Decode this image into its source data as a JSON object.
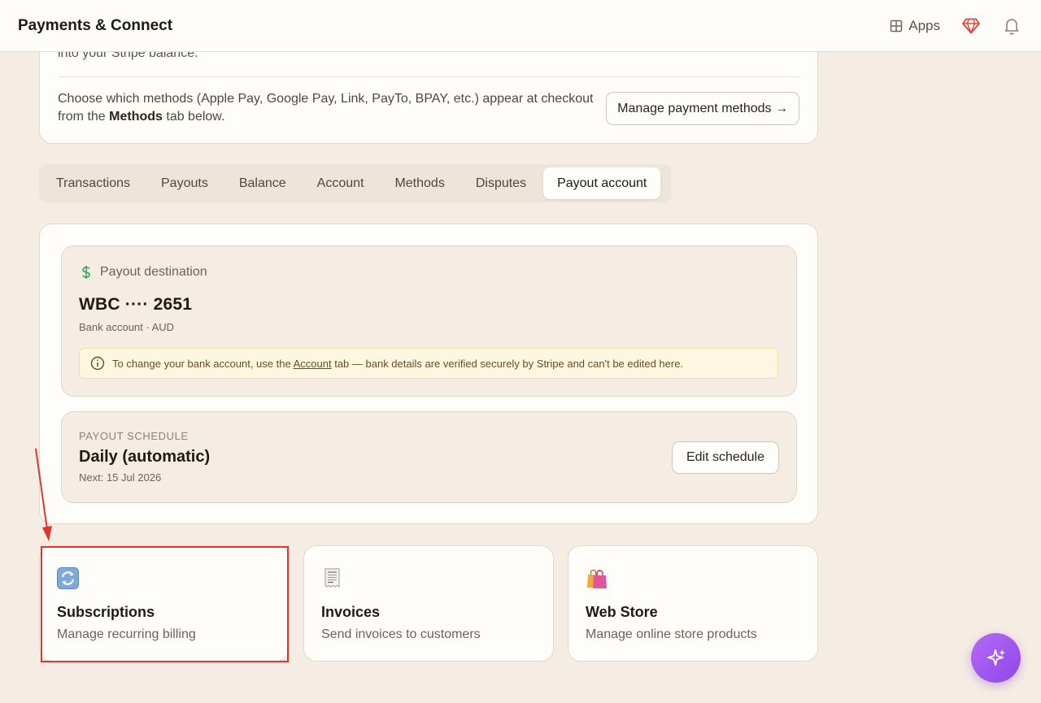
{
  "header": {
    "title": "Payments & Connect",
    "apps_label": "Apps"
  },
  "upper_card": {
    "clipped_text": "into your Stripe balance.",
    "desc_before": "Choose which methods (Apple Pay, Google Pay, Link, PayTo, BPAY, etc.) appear at checkout from the ",
    "desc_bold": "Methods",
    "desc_after": " tab below.",
    "manage_button": "Manage payment methods →"
  },
  "tabs": [
    {
      "label": "Transactions",
      "active": false
    },
    {
      "label": "Payouts",
      "active": false
    },
    {
      "label": "Balance",
      "active": false
    },
    {
      "label": "Account",
      "active": false
    },
    {
      "label": "Methods",
      "active": false
    },
    {
      "label": "Disputes",
      "active": false
    },
    {
      "label": "Payout account",
      "active": true
    }
  ],
  "payout_destination": {
    "heading": "Payout destination",
    "account": "WBC ···· 2651",
    "account_type": "Bank account · AUD",
    "notice_before": "To change your bank account, use the ",
    "notice_link": "Account",
    "notice_after": " tab — bank details are verified securely by Stripe and can't be edited here."
  },
  "payout_schedule": {
    "label": "PAYOUT SCHEDULE",
    "value": "Daily (automatic)",
    "next": "Next: 15 Jul 2026",
    "edit_button": "Edit schedule"
  },
  "cards": [
    {
      "icon": "arrows-cycle-icon",
      "title": "Subscriptions",
      "subtitle": "Manage recurring billing"
    },
    {
      "icon": "receipt-icon",
      "title": "Invoices",
      "subtitle": "Send invoices to customers"
    },
    {
      "icon": "shopping-bags-icon",
      "title": "Web Store",
      "subtitle": "Manage online store products"
    }
  ],
  "colors": {
    "background": "#f5ede3",
    "annotation": "#e2342a",
    "fab": "#9b51ee"
  }
}
